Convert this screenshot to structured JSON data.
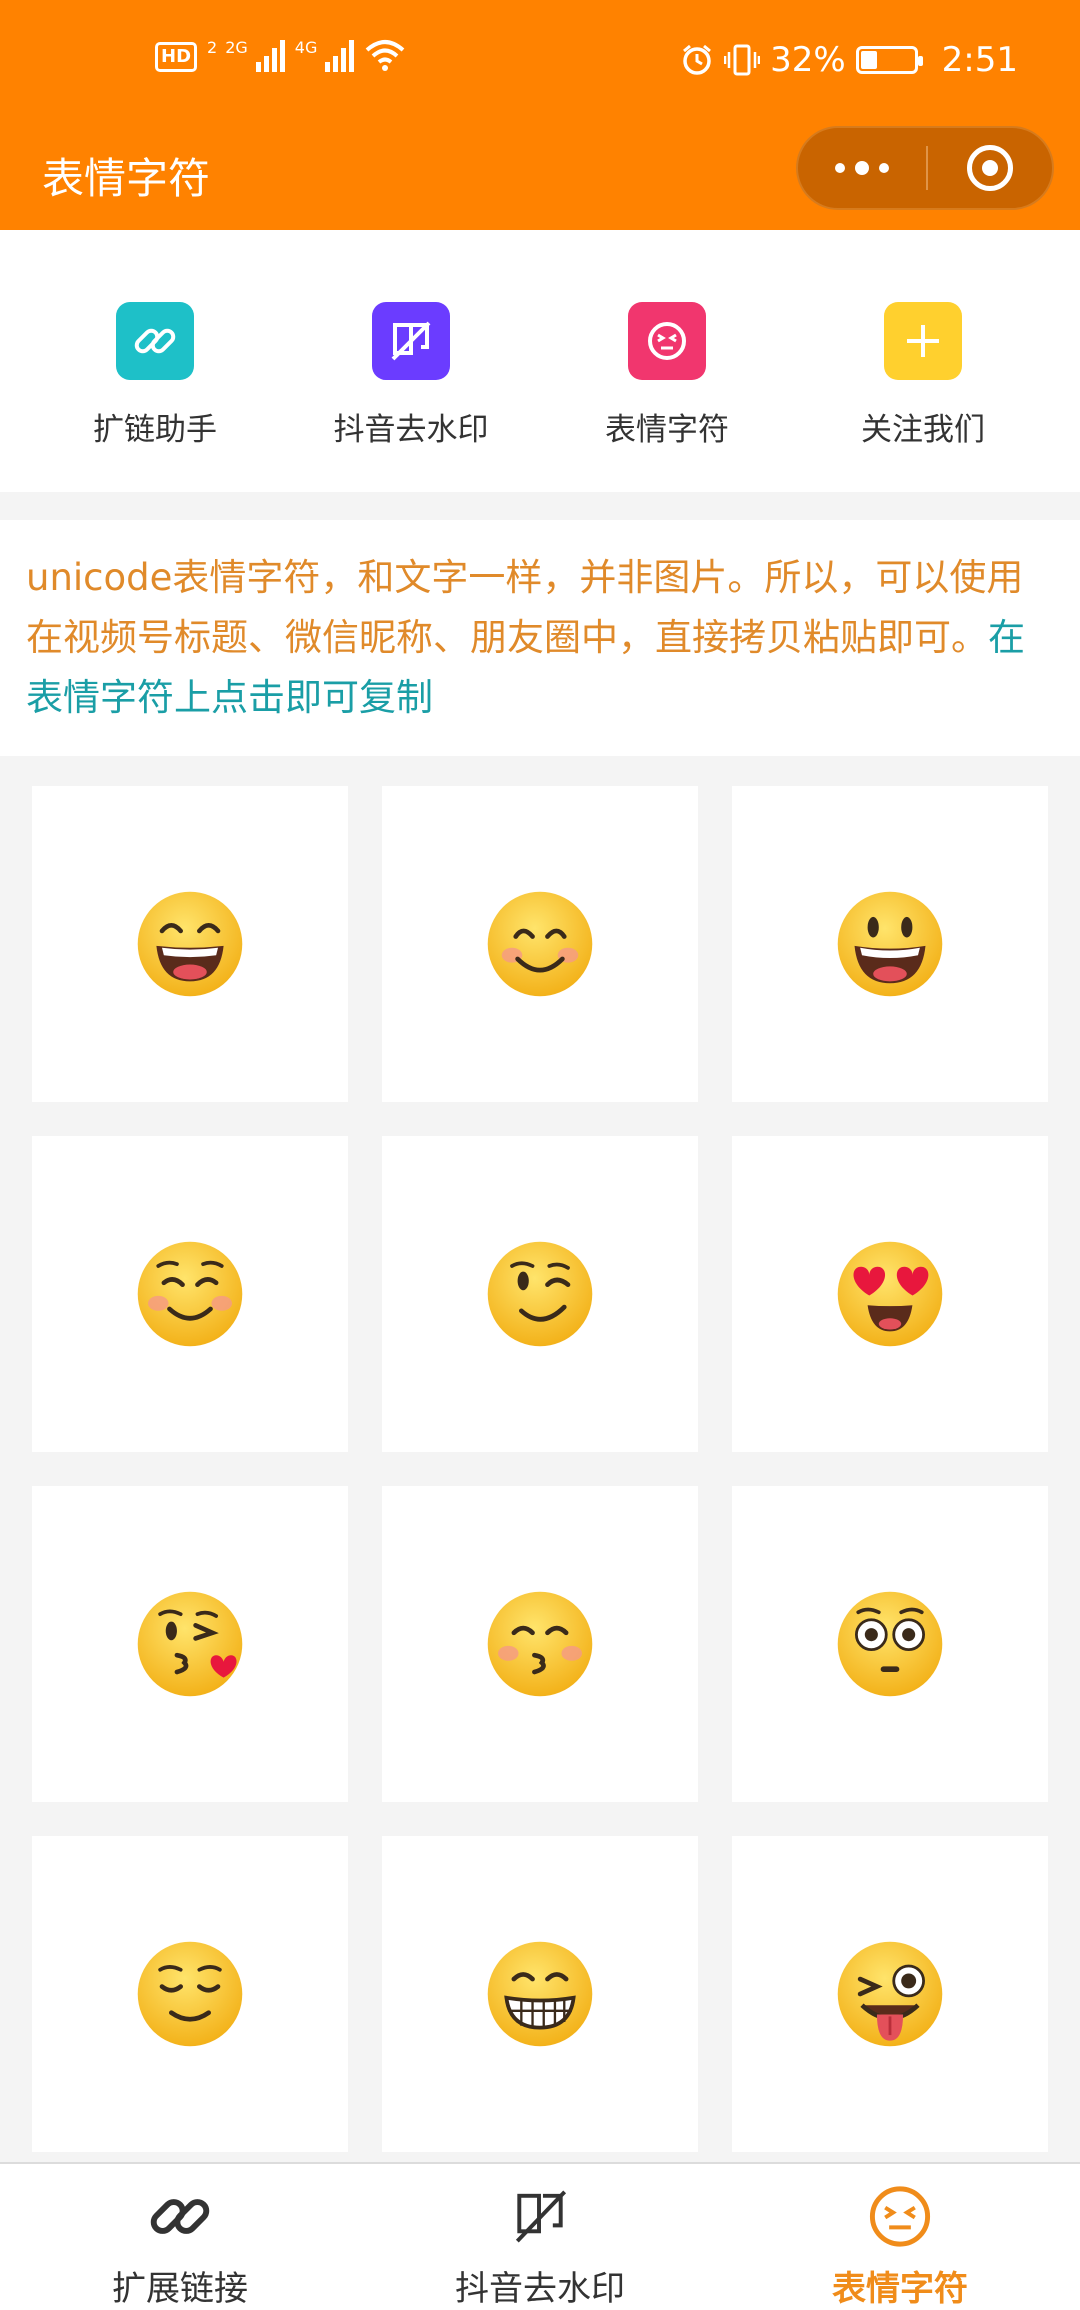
{
  "status_bar": {
    "hd_badge": "HD",
    "sim2": "2",
    "net1": "2G",
    "net2": "4G",
    "battery": "32%",
    "time": "2:51"
  },
  "header": {
    "title": "表情字符",
    "more_icon": "ellipsis-icon",
    "close_icon": "target-icon"
  },
  "quick_nav": [
    {
      "label": "扩链助手",
      "icon": "link-icon",
      "color": "#1ec0c8"
    },
    {
      "label": "抖音去水印",
      "icon": "no-watermark-icon",
      "color": "#6b3cff"
    },
    {
      "label": "表情字符",
      "icon": "emoji-face-icon",
      "color": "#f1366e"
    },
    {
      "label": "关注我们",
      "icon": "plus-icon",
      "color": "#ffd02e"
    }
  ],
  "description": {
    "main": "unicode表情字符，和文字一样，并非图片。所以，可以使用在视频号标题、微信昵称、朋友圈中，直接拷贝粘贴即可。",
    "hint": "在表情字符上点击即可复制"
  },
  "emojis": [
    "grinning-squinting-face",
    "smiling-face-with-blush",
    "grinning-face",
    "smiling-face-closed-eyes",
    "winking-face",
    "heart-eyes-face",
    "face-blowing-kiss",
    "kissing-face-smiling-eyes",
    "flushed-face",
    "relieved-face",
    "grimacing-grin-face",
    "winking-tongue-face"
  ],
  "tab_bar": [
    {
      "label": "扩展链接",
      "icon": "link-icon",
      "active": false
    },
    {
      "label": "抖音去水印",
      "icon": "no-watermark-icon",
      "active": false
    },
    {
      "label": "表情字符",
      "icon": "emoji-face-icon",
      "active": true
    }
  ],
  "colors": {
    "brand": "#ff8200",
    "active_tab": "#f08c1a",
    "description_text": "#e08a2a",
    "hint_text": "#1a9ea6"
  }
}
